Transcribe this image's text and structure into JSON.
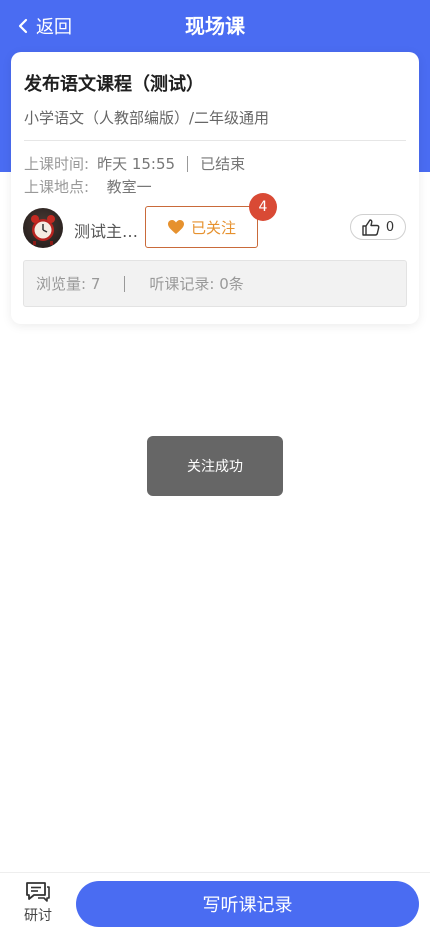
{
  "nav": {
    "back_label": "返回",
    "title": "现场课"
  },
  "course": {
    "title": "发布语文课程（测试）",
    "subtitle": "小学语文（人教部编版）/二年级通用",
    "time_label": "上课时间:",
    "time_value": "昨天 15:55",
    "status": "已结束",
    "place_label": "上课地点:",
    "place_value": "教室一"
  },
  "host": {
    "name": "测试主…",
    "follow_label": "已关注",
    "follow_badge": "4",
    "like_count": "0"
  },
  "stats": {
    "views": "浏览量: 7",
    "records": "听课记录: 0条"
  },
  "toast": {
    "message": "关注成功"
  },
  "bottom": {
    "discuss_label": "研讨",
    "write_button": "写听课记录"
  },
  "colors": {
    "primary": "#4a6cf2",
    "follow_text": "#e6912e",
    "badge": "#d94a35"
  }
}
